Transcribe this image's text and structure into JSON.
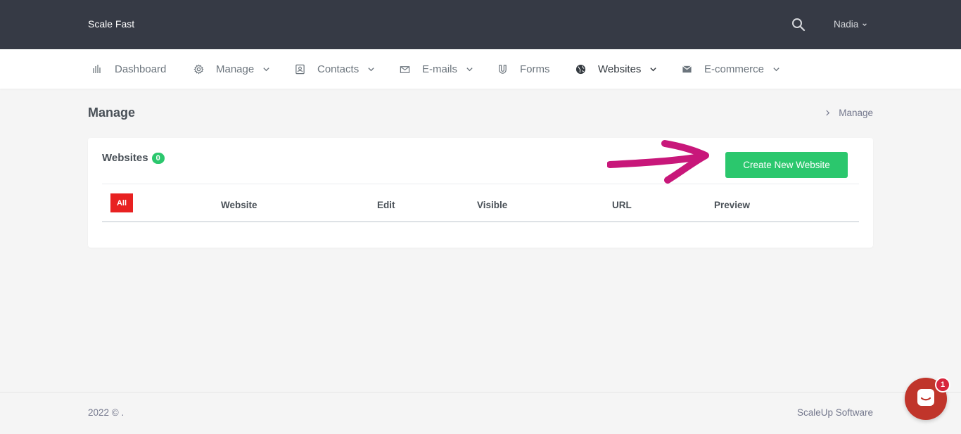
{
  "topbar": {
    "brand": "Scale Fast",
    "user": "Nadia"
  },
  "nav": {
    "items": [
      {
        "label": "Dashboard",
        "icon": "bar-chart-icon"
      },
      {
        "label": "Manage",
        "icon": "gear-icon"
      },
      {
        "label": "Contacts",
        "icon": "contact-card-icon"
      },
      {
        "label": "E-mails",
        "icon": "envelope-icon"
      },
      {
        "label": "Forms",
        "icon": "magnet-icon"
      },
      {
        "label": "Websites",
        "icon": "globe-icon"
      },
      {
        "label": "E-commerce",
        "icon": "mail-box-icon"
      }
    ]
  },
  "page": {
    "title": "Manage",
    "breadcrumb": "Manage"
  },
  "card": {
    "title": "Websites",
    "count": "0",
    "create_button": "Create New Website"
  },
  "table": {
    "filter_all": "All",
    "headers": [
      "Website",
      "Edit",
      "Visible",
      "URL",
      "Preview"
    ]
  },
  "footer": {
    "left": "2022 © .",
    "right": "ScaleUp Software"
  },
  "chat": {
    "badge": "1"
  },
  "colors": {
    "topbar": "#363a45",
    "accent_green": "#2bc76d",
    "filter_red": "#e82121",
    "annotation_arrow": "#c8177a",
    "chat_button": "#c0352b"
  }
}
